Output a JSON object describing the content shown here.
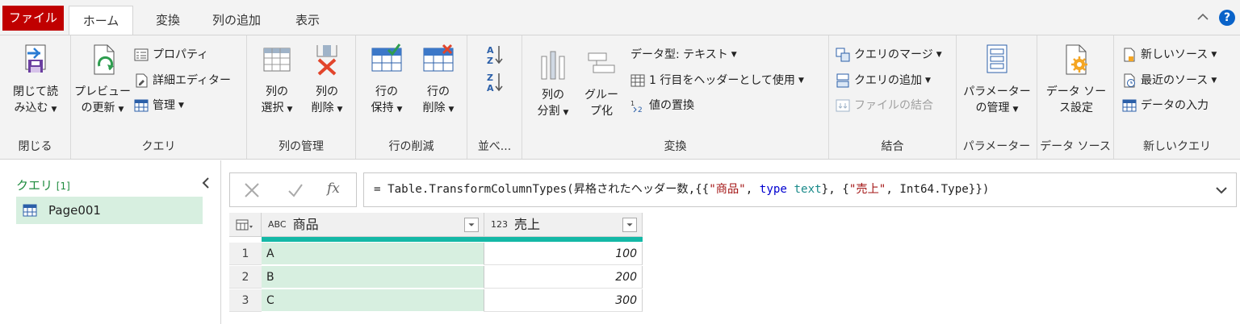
{
  "tabs": {
    "file": "ファイル",
    "home": "ホーム",
    "transform": "変換",
    "add_column": "列の追加",
    "view": "表示"
  },
  "help": "?",
  "ribbon": {
    "close": {
      "label": "閉じる",
      "close_load_1": "閉じて読",
      "close_load_2": "み込む"
    },
    "query": {
      "label": "クエリ",
      "refresh_1": "プレビュー",
      "refresh_2": "の更新",
      "properties": "プロパティ",
      "advanced_editor": "詳細エディター",
      "manage": "管理"
    },
    "manage_columns": {
      "label": "列の管理",
      "choose_1": "列の",
      "choose_2": "選択",
      "remove_1": "列の",
      "remove_2": "削除"
    },
    "reduce_rows": {
      "label": "行の削減",
      "keep_1": "行の",
      "keep_2": "保持",
      "remove_1": "行の",
      "remove_2": "削除"
    },
    "sort": {
      "label": "並べ..."
    },
    "transform": {
      "label": "変換",
      "split_1": "列の",
      "split_2": "分割",
      "group_1": "グルー",
      "group_2": "プ化",
      "data_type": "データ型: テキスト",
      "use_first_row": "1 行目をヘッダーとして使用",
      "replace_values": "値の置換"
    },
    "combine": {
      "label": "結合",
      "merge": "クエリのマージ",
      "append": "クエリの追加",
      "combine_files": "ファイルの結合"
    },
    "parameters": {
      "label": "パラメーター",
      "manage_1": "パラメーター",
      "manage_2": "の管理"
    },
    "data_source": {
      "label": "データ ソース",
      "settings_1": "データ ソー",
      "settings_2": "ス設定"
    },
    "new_query": {
      "label": "新しいクエリ",
      "new_source": "新しいソース",
      "recent_sources": "最近のソース",
      "enter_data": "データの入力"
    }
  },
  "query_pane": {
    "title": "クエリ",
    "count": "[1]",
    "items": [
      {
        "name": "Page001"
      }
    ]
  },
  "formula_bar": {
    "fx": "fx",
    "formula_parts": {
      "p1": "= Table.TransformColumnTypes(昇格されたヘッダー数,{{",
      "s1": "\"商品\"",
      "p2": ", ",
      "k1": "type",
      "p3": " ",
      "t1": "text",
      "p4": "}, {",
      "s2": "\"売上\"",
      "p5": ", Int64.Type}})"
    }
  },
  "grid": {
    "columns": [
      {
        "type_icon": "ABC",
        "name": "商品"
      },
      {
        "type_icon": "123",
        "name": "売上"
      }
    ],
    "rows": [
      {
        "num": "1",
        "product": "A",
        "sales": "100"
      },
      {
        "num": "2",
        "product": "B",
        "sales": "200"
      },
      {
        "num": "3",
        "product": "C",
        "sales": "300"
      }
    ]
  },
  "colors": {
    "file_tab": "#c00000",
    "accent_green": "#1e8b3e",
    "selected_fill": "#d7efe0",
    "quality_bar": "#14b8a6",
    "help": "#0a63c9"
  }
}
